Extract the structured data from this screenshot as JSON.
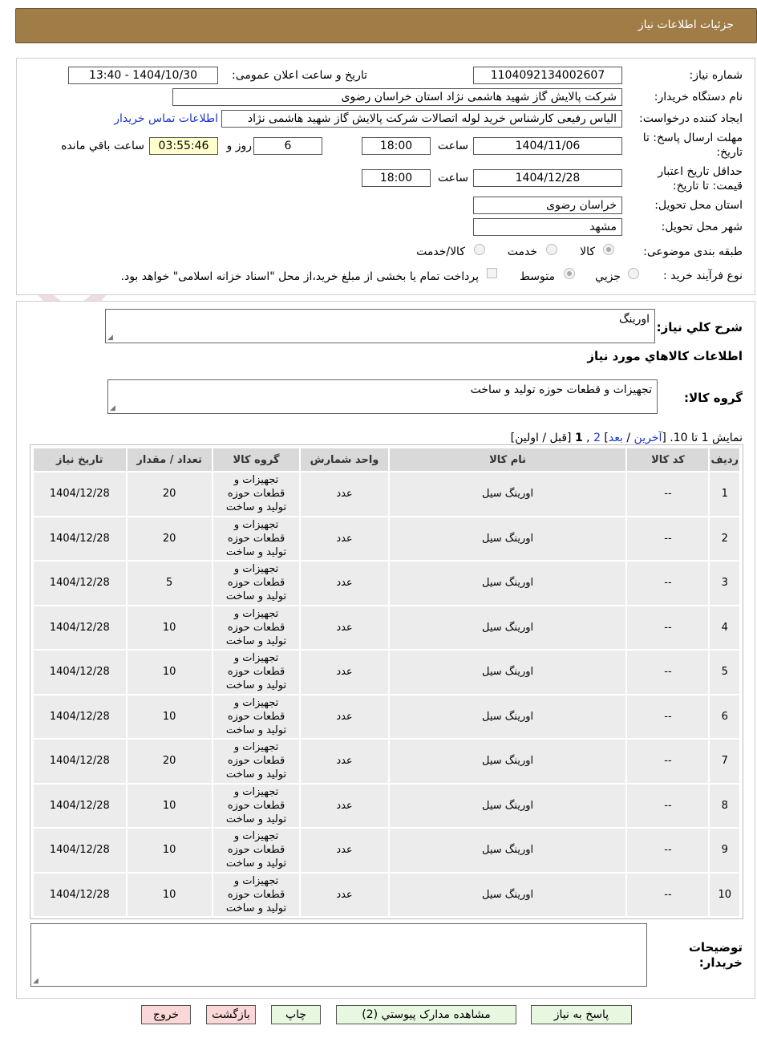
{
  "header": {
    "title": "جزئیات اطلاعات نیاز"
  },
  "watermark_text": "AriaTender.net",
  "form": {
    "need_number_label": "شماره نیاز:",
    "need_number": "1104092134002607",
    "announce_label": "تاریخ و ساعت اعلان عمومی:",
    "announce_value": "1404/10/30 - 13:40",
    "buyer_org_label": "نام دستگاه خریدار:",
    "buyer_org": "شرکت پالایش گاز شهید هاشمی نژاد   استان خراسان رضوی",
    "creator_label": "ایجاد کننده درخواست:",
    "creator": "الیاس رفیعی کارشناس خرید لوله اتصالات شرکت پالایش گاز شهید هاشمی نژاد",
    "contact_link": "اطلاعات تماس خریدار",
    "deadline_label": "مهلت ارسال پاسخ: تا تاریخ:",
    "deadline_date": "1404/11/06",
    "time_label": "ساعت",
    "deadline_time": "18:00",
    "days_value": "6",
    "days_label": "روز و",
    "remaining_time": "03:55:46",
    "remaining_label": "ساعت باقي مانده",
    "validity_label": "حداقل تاریخ اعتبار قیمت: تا تاریخ:",
    "validity_date": "1404/12/28",
    "validity_time": "18:00",
    "province_label": "استان محل تحویل:",
    "province": "خراسان رضوی",
    "city_label": "شهر محل تحویل:",
    "city": "مشهد",
    "category_label": "طبقه بندی موضوعی:",
    "category_options": [
      "کالا",
      "خدمت",
      "کالا/خدمت"
    ],
    "purchase_type_label": "نوع فرآیند خرید :",
    "purchase_options": [
      "جزیي",
      "متوسط"
    ],
    "payment_note": "پرداخت تمام یا بخشی از مبلغ خرید،از محل \"اسناد خزانه اسلامی\" خواهد بود."
  },
  "summary": {
    "desc_label": "شرح کلي نیاز:",
    "desc_value": "اورینگ",
    "goods_info_title": "اطلاعات کالاهاي مورد نیاز",
    "group_label": "گروه کالا:",
    "group_value": "تجهیزات و قطعات حوزه تولید و ساخت"
  },
  "pagination": {
    "prefix": "نمایش 1 تا 10. [",
    "last": "آخرین",
    "sep1": " / ",
    "next": "بعد",
    "mid": "] ",
    "page2": "2",
    "comma": " ,",
    "page1": "1",
    "suffix": " [قبل / اولین]"
  },
  "table": {
    "headers": [
      "ردیف",
      "کد کالا",
      "نام کالا",
      "واحد شمارش",
      "گروه کالا",
      "تعداد / مقدار",
      "تاریخ نیاز"
    ],
    "rows": [
      [
        "1",
        "--",
        "اورینگ سیل",
        "عدد",
        "تجهیزات و قطعات حوزه تولید و ساخت",
        "20",
        "1404/12/28"
      ],
      [
        "2",
        "--",
        "اورینگ سیل",
        "عدد",
        "تجهیزات و قطعات حوزه تولید و ساخت",
        "20",
        "1404/12/28"
      ],
      [
        "3",
        "--",
        "اورینگ سیل",
        "عدد",
        "تجهیزات و قطعات حوزه تولید و ساخت",
        "5",
        "1404/12/28"
      ],
      [
        "4",
        "--",
        "اورینگ سیل",
        "عدد",
        "تجهیزات و قطعات حوزه تولید و ساخت",
        "10",
        "1404/12/28"
      ],
      [
        "5",
        "--",
        "اورینگ سیل",
        "عدد",
        "تجهیزات و قطعات حوزه تولید و ساخت",
        "10",
        "1404/12/28"
      ],
      [
        "6",
        "--",
        "اورینگ سیل",
        "عدد",
        "تجهیزات و قطعات حوزه تولید و ساخت",
        "10",
        "1404/12/28"
      ],
      [
        "7",
        "--",
        "اورینگ سیل",
        "عدد",
        "تجهیزات و قطعات حوزه تولید و ساخت",
        "20",
        "1404/12/28"
      ],
      [
        "8",
        "--",
        "اورینگ سیل",
        "عدد",
        "تجهیزات و قطعات حوزه تولید و ساخت",
        "10",
        "1404/12/28"
      ],
      [
        "9",
        "--",
        "اورینگ سیل",
        "عدد",
        "تجهیزات و قطعات حوزه تولید و ساخت",
        "10",
        "1404/12/28"
      ],
      [
        "10",
        "--",
        "اورینگ سیل",
        "عدد",
        "تجهیزات و قطعات حوزه تولید و ساخت",
        "10",
        "1404/12/28"
      ]
    ]
  },
  "buyer_notes": {
    "label": "توضیحات خریدار:",
    "value": ""
  },
  "buttons": {
    "reply": "پاسخ به نیاز",
    "attachments": "مشاهده مدارک پیوستي (2)",
    "print": "چاپ",
    "back": "بازگشت",
    "exit": "خروج"
  },
  "colors": {
    "header_bg": "#a07c47",
    "link": "#1a36c9",
    "timer_bg": "#ffffcc",
    "btn_green": "#e8f7e0",
    "btn_pink": "#fcd7d7"
  }
}
